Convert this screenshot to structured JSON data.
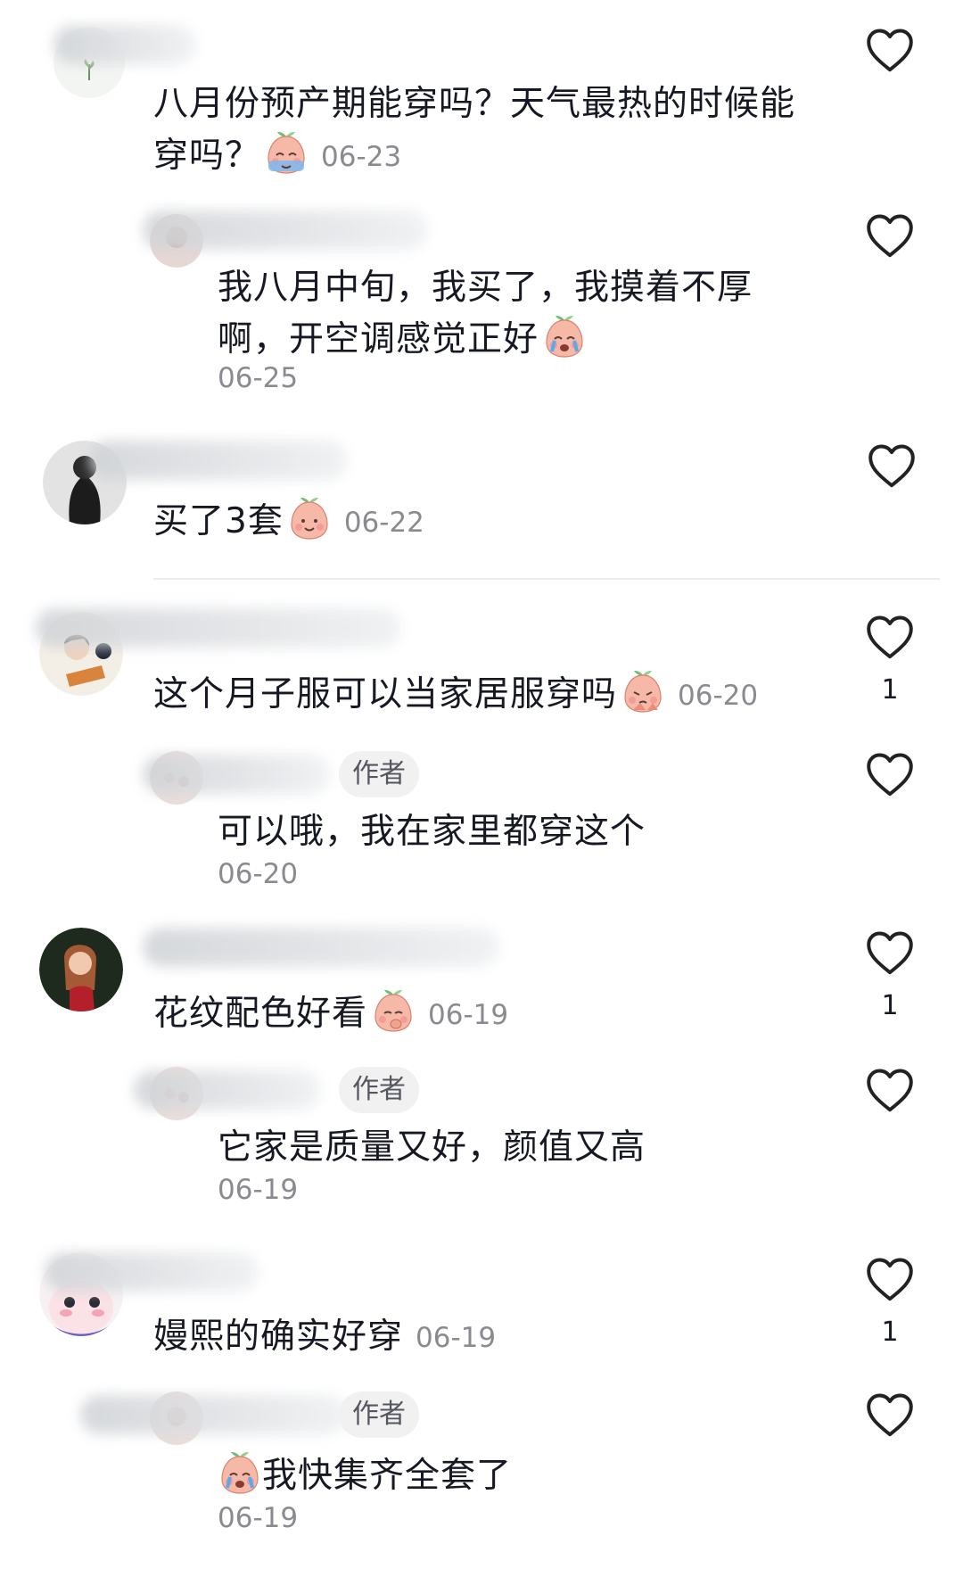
{
  "comments": [
    {
      "text": "八月份预产期能穿吗？天气最热的时候能穿吗？",
      "emoji": "crying-face-emoji",
      "date": "06-23",
      "reply": {
        "text": "我八月中旬，我买了，我摸着不厚啊，开空调感觉正好",
        "emoji": "crying-face-emoji",
        "date": "06-25"
      }
    },
    {
      "text": "买了3套",
      "emoji": "smiling-face-emoji",
      "date": "06-22"
    },
    {
      "text": "这个月子服可以当家居服穿吗",
      "emoji": "pleading-face-emoji",
      "date": "06-20",
      "likes": "1",
      "reply": {
        "badge": "作者",
        "text": "可以哦，我在家里都穿这个",
        "date": "06-20"
      }
    },
    {
      "text": "花纹配色好看",
      "emoji": "blushing-face-emoji",
      "date": "06-19",
      "likes": "1",
      "reply": {
        "badge": "作者",
        "text": "它家是质量又好，颜值又高",
        "date": "06-19"
      }
    },
    {
      "text": "嫚熙的确实好穿",
      "date": "06-19",
      "likes": "1",
      "reply": {
        "badge": "作者",
        "emoji": "crying-face-emoji",
        "text": "我快集齐全套了",
        "date": "06-19"
      }
    }
  ],
  "icons": {
    "like": "heart-outline-icon"
  },
  "colors": {
    "text": "#161823",
    "date": "#8a8b91",
    "badge_bg": "#f1f1f2",
    "emoji_face": "#f6b9a8",
    "emoji_leaf": "#6fbf73"
  }
}
